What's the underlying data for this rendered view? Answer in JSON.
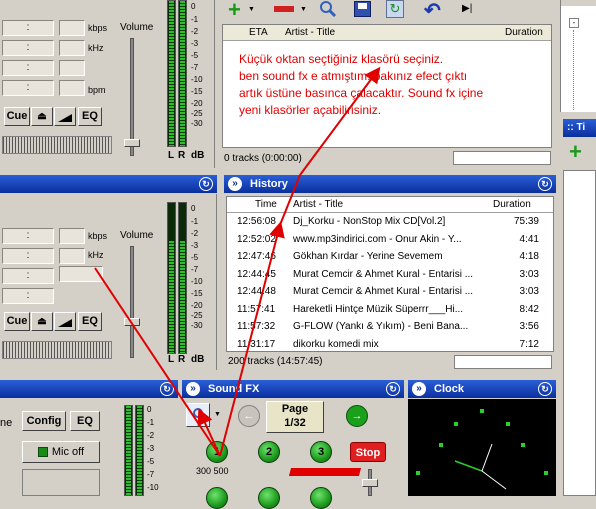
{
  "deck1": {
    "fields": [
      ":",
      ":",
      ":",
      ":"
    ],
    "units": [
      "kbps",
      "kHz",
      "",
      "bpm"
    ],
    "volume_label": "Volume",
    "cue_label": "Cue",
    "eq_label": "EQ",
    "scale": [
      "0",
      "-1",
      "-2",
      "-3",
      "-5",
      "-7",
      "-10",
      "-15",
      "-20",
      "-25",
      "-30"
    ],
    "meter_labels": [
      "L",
      "R",
      "dB"
    ]
  },
  "deck2": {
    "fields": [
      ":",
      ":",
      ":",
      ":"
    ],
    "units": [
      "kbps",
      "kHz",
      "",
      ""
    ],
    "volume_label": "Volume",
    "cue_label": "Cue",
    "eq_label": "EQ",
    "scale": [
      "0",
      "-1",
      "-2",
      "-3",
      "-5",
      "-7",
      "-10",
      "-15",
      "-20",
      "-25",
      "-30"
    ],
    "meter_labels": [
      "L",
      "R",
      "dB"
    ]
  },
  "playlist": {
    "columns": [
      "ETA",
      "Artist - Title",
      "Duration"
    ],
    "annotation_lines": [
      "Küçük oktan seçtiğiniz klasörü seçiniz.",
      "ben sound fx e atmıştım. bakınız efect çıktı",
      "artık üstüne basınca çalacaktır.  Sound fx içine",
      "yeni klasörler açabilirisiniz."
    ],
    "status": "0 tracks (0:00:00)"
  },
  "history": {
    "title": "History",
    "columns": [
      "Time",
      "Artist - Title",
      "Duration"
    ],
    "rows": [
      {
        "time": "12:56:08",
        "title": "Dj_Korku - NonStop Mix CD[Vol.2]",
        "duration": "75:39"
      },
      {
        "time": "12:52:02",
        "title": "www.mp3indirici.com - Onur Akin - Y...",
        "duration": "4:41"
      },
      {
        "time": "12:47:46",
        "title": "Gökhan Kırdar - Yerine Sevemem",
        "duration": "4:18"
      },
      {
        "time": "12:44:45",
        "title": "Murat Cemcir & Ahmet Kural - Entarisi ...",
        "duration": "3:03"
      },
      {
        "time": "12:44:48",
        "title": "Murat Cemcir & Ahmet Kural - Entarisi ...",
        "duration": "3:03"
      },
      {
        "time": "11:57:41",
        "title": "Hareketli Hintçe Müzik Süperrr___Hi...",
        "duration": "8:42"
      },
      {
        "time": "11:57:32",
        "title": "G-FLOW (Yankı & Yıkım) - Beni Bana...",
        "duration": "3:56"
      },
      {
        "time": "11:31:17",
        "title": "dikorku komedi mix",
        "duration": "7:12"
      }
    ],
    "status": "200 tracks (14:57:45)"
  },
  "mic": {
    "label_partial": "ne",
    "config_label": "Config",
    "eq_label": "EQ",
    "mic_label": "Mic off",
    "scale": [
      "0",
      "-1",
      "-2",
      "-3",
      "-5",
      "-7",
      "-10"
    ]
  },
  "soundfx": {
    "title": "Sound FX",
    "page_label": "Page",
    "page_value": "1/32",
    "buttons": [
      "1",
      "2",
      "3"
    ],
    "stop_label": "Stop",
    "caption_1": "300 500"
  },
  "clock": {
    "title": "Clock"
  },
  "right_panel": {
    "title": ":: Ti"
  },
  "colors": {
    "titlebar": "#0a2f9e",
    "annotation": "#e00000",
    "meter_green": "#2dbd2d",
    "arrow": "#e00000"
  }
}
